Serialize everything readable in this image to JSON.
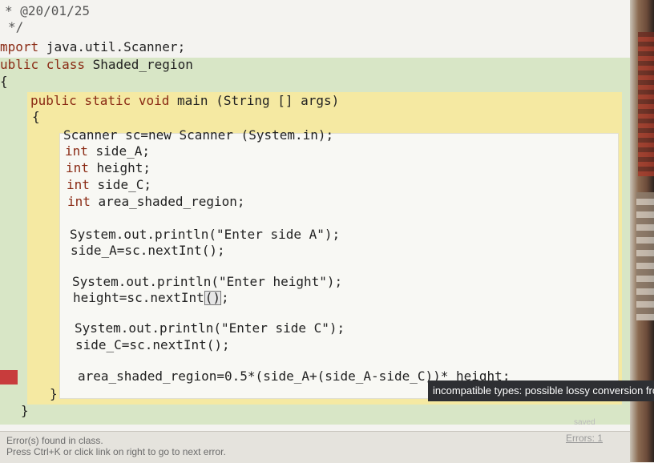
{
  "header": {
    "comment_line": "* @20/01/25",
    "comment_end": "*/"
  },
  "code": {
    "import_kw": "mport",
    "import_rest": " java.util.Scanner;",
    "class_kw": "ublic class",
    "class_name": " Shaded_region",
    "class_open": "{",
    "method_sig_kw": "public static void",
    "method_sig_rest": " main (String [] args)",
    "method_open": "{",
    "l1": "Scanner sc=new Scanner (System.in);",
    "l2_kw": "int",
    "l2_rest": " side_A;",
    "l3_kw": "int",
    "l3_rest": " height;",
    "l4_kw": "int",
    "l4_rest": " side_C;",
    "l5_kw": "int",
    "l5_rest": " area_shaded_region;",
    "l6": "System.out.println(\"Enter side A\");",
    "l7": "side_A=sc.nextInt();",
    "l8": "System.out.println(\"Enter height\");",
    "l9_a": "height=sc.nextInt",
    "l9_b": "()",
    "l9_c": ";",
    "l10": "System.out.println(\"Enter side C\");",
    "l11": "side_C=sc.nextInt();",
    "l12_a": "area_shaded_region=0.5*(side_A+(side_A-side_C))* ",
    "l12_b": "height;",
    "method_close": "}",
    "class_close": "}"
  },
  "tooltip": {
    "text": "incompatible types: possible lossy conversion fror"
  },
  "status": {
    "line1": "Error(s) found in class.",
    "line2": "Press Ctrl+K or click link on right to go to next error.",
    "errors_link": "Errors: 1",
    "saved": "saved"
  },
  "colors": {
    "keyword": "#8a2a14",
    "class_scope": "#d8e6c6",
    "method_scope": "#f5e9a2",
    "error_marker": "#c83c3c",
    "tooltip_bg": "#2e2f33"
  }
}
